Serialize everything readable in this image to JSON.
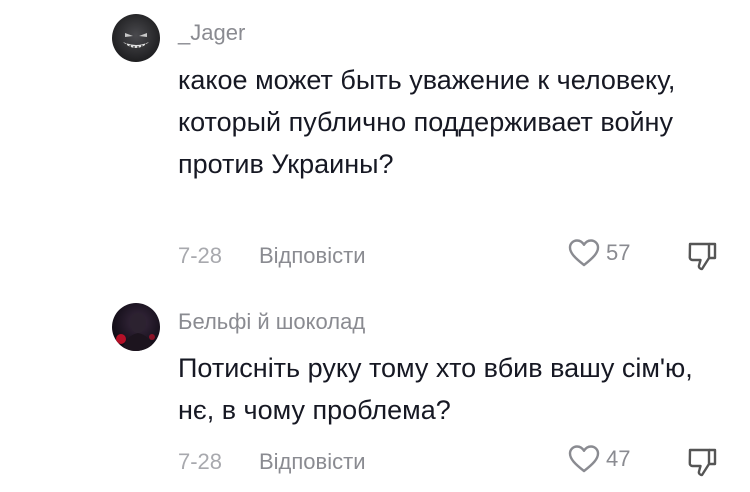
{
  "comments": [
    {
      "username": "_Jager",
      "text": "какое может быть уважение к человеку, который публично поддерживает войну против Украины?",
      "date": "7-28",
      "reply_label": "Відповісти",
      "likes": "57",
      "avatar_icon": "dark-grinning-face-avatar",
      "accent": "#a01010"
    },
    {
      "username": "Бельфі й шоколад",
      "text": "Потисніть руку тому хто вбив вашу сім'ю, нє, в чому проблема?",
      "date": "7-28",
      "reply_label": "Відповісти",
      "likes": "47",
      "avatar_icon": "dark-portrait-red-light-avatar",
      "accent": "#d0102a"
    }
  ],
  "icons": {
    "like": "heart-outline-icon",
    "dislike": "thumbs-down-outline-icon"
  }
}
